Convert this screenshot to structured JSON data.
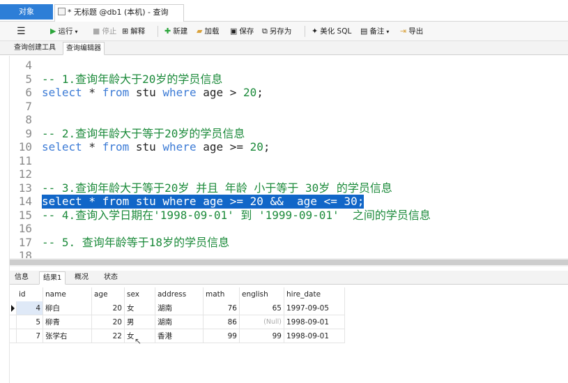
{
  "topbar": {
    "objects_tab": "对象",
    "query_tab": "* 无标题 @db1 (本机) - 查询"
  },
  "toolbar": {
    "menu_icon": "hamburger-icon",
    "run": "运行",
    "stop": "停止",
    "explain": "解释",
    "new": "新建",
    "load": "加载",
    "save": "保存",
    "save_as": "另存为",
    "beautify": "美化 SQL",
    "note": "备注",
    "export": "导出"
  },
  "subtabs": {
    "builder": "查询创建工具",
    "editor": "查询编辑器"
  },
  "editor": {
    "lines": [
      {
        "n": "4",
        "text": ""
      },
      {
        "n": "5",
        "text": "-- 1.查询年龄大于20岁的学员信息"
      },
      {
        "n": "6",
        "text": "select * from stu where age > 20;"
      },
      {
        "n": "7",
        "text": ""
      },
      {
        "n": "8",
        "text": ""
      },
      {
        "n": "9",
        "text": "-- 2.查询年龄大于等于20岁的学员信息"
      },
      {
        "n": "10",
        "text": "select * from stu where age >= 20;"
      },
      {
        "n": "11",
        "text": ""
      },
      {
        "n": "12",
        "text": ""
      },
      {
        "n": "13",
        "text": "-- 3.查询年龄大于等于20岁 并且 年龄 小于等于 30岁 的学员信息"
      },
      {
        "n": "14",
        "text": "select * from stu where age >= 20 &&  age <= 30;"
      },
      {
        "n": "15",
        "text": "-- 4.查询入学日期在'1998-09-01' 到 '1999-09-01'  之间的学员信息"
      },
      {
        "n": "16",
        "text": ""
      },
      {
        "n": "17",
        "text": "-- 5. 查询年龄等于18岁的学员信息"
      },
      {
        "n": "18",
        "text": ""
      }
    ]
  },
  "result_tabs": [
    "信息",
    "结果1",
    "概况",
    "状态"
  ],
  "grid": {
    "columns": [
      "id",
      "name",
      "age",
      "sex",
      "address",
      "math",
      "english",
      "hire_date"
    ],
    "rows": [
      [
        "4",
        "柳白",
        "20",
        "女",
        "湖南",
        "76",
        "65",
        "1997-09-05"
      ],
      [
        "5",
        "柳青",
        "20",
        "男",
        "湖南",
        "86",
        "(Null)",
        "1998-09-01"
      ],
      [
        "7",
        "张学右",
        "22",
        "女",
        "香港",
        "99",
        "99",
        "1998-09-01"
      ]
    ]
  },
  "colors": {
    "accent": "#2d7ed7",
    "comment": "#1b8a3a",
    "keyword": "#3c7bd6",
    "selection": "#1166c8"
  }
}
